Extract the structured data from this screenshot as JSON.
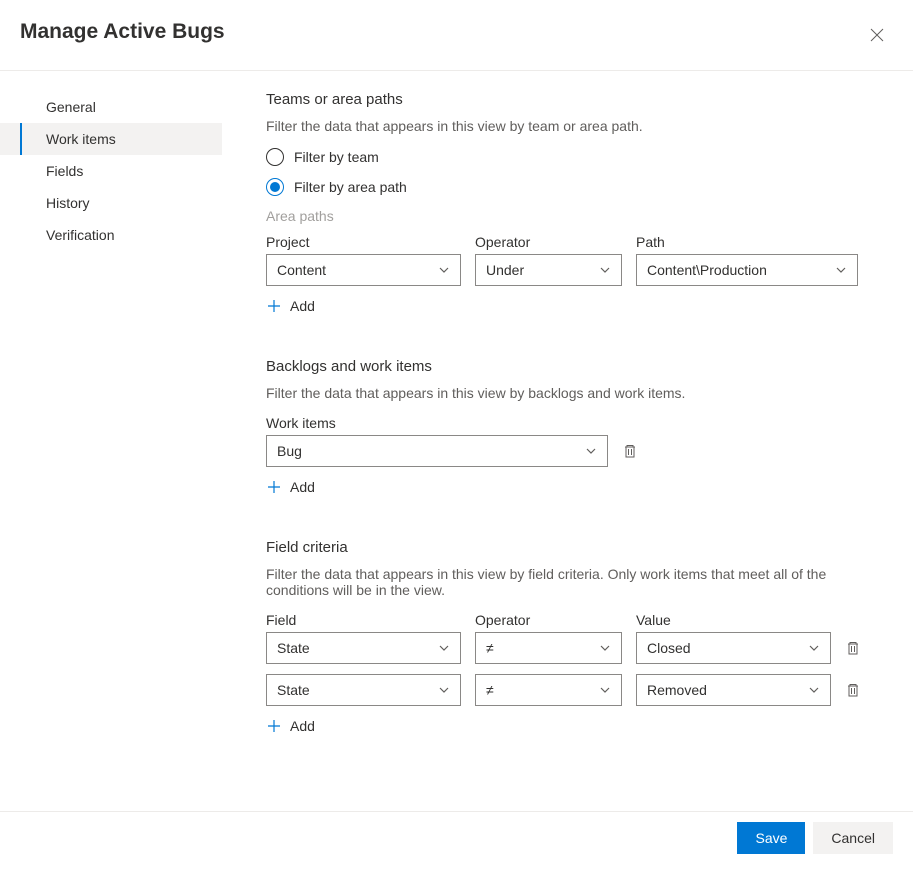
{
  "title": "Manage Active Bugs",
  "sidebar": {
    "items": [
      {
        "label": "General"
      },
      {
        "label": "Work items"
      },
      {
        "label": "Fields"
      },
      {
        "label": "History"
      },
      {
        "label": "Verification"
      }
    ],
    "activeIndex": 1
  },
  "teams_section": {
    "title": "Teams or area paths",
    "desc": "Filter the data that appears in this view by team or area path.",
    "radio_team": "Filter by team",
    "radio_area": "Filter by area path",
    "selected": "area",
    "sub_label": "Area paths",
    "col_project": "Project",
    "col_operator": "Operator",
    "col_path": "Path",
    "row": {
      "project": "Content",
      "operator": "Under",
      "path": "Content\\Production"
    },
    "add_label": "Add"
  },
  "backlogs_section": {
    "title": "Backlogs and work items",
    "desc": "Filter the data that appears in this view by backlogs and work items.",
    "col_workitems": "Work items",
    "row": {
      "workitem": "Bug"
    },
    "add_label": "Add"
  },
  "criteria_section": {
    "title": "Field criteria",
    "desc": "Filter the data that appears in this view by field criteria. Only work items that meet all of the conditions will be in the view.",
    "col_field": "Field",
    "col_operator": "Operator",
    "col_value": "Value",
    "rows": [
      {
        "field": "State",
        "operator": "≠",
        "value": "Closed"
      },
      {
        "field": "State",
        "operator": "≠",
        "value": "Removed"
      }
    ],
    "add_label": "Add"
  },
  "footer": {
    "save": "Save",
    "cancel": "Cancel"
  }
}
